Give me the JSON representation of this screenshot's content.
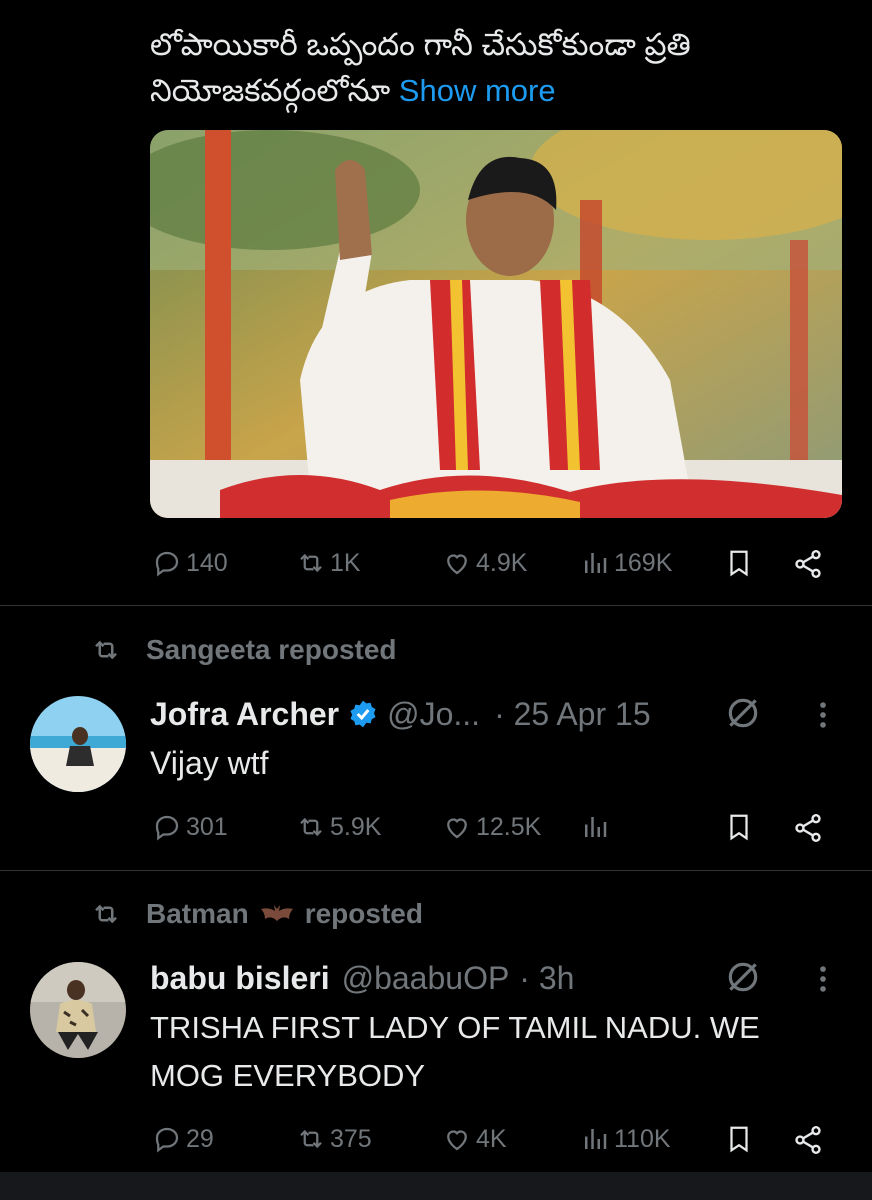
{
  "tweet1": {
    "text_line1": "లోపాయికారీ ఒప్పందం గానీ చేసుకోకుండా ప్రతి",
    "text_line2": "నియోజకవర్గంలోనూ",
    "show_more": "Show more",
    "actions": {
      "replies": "140",
      "reposts": "1K",
      "likes": "4.9K",
      "views": "169K"
    }
  },
  "tweet2": {
    "repost_by": "Sangeeta reposted",
    "name": "Jofra Archer",
    "handle": "@Jo...",
    "time": "· 25 Apr 15",
    "text": "Vijay wtf",
    "actions": {
      "replies": "301",
      "reposts": "5.9K",
      "likes": "12.5K"
    }
  },
  "tweet3": {
    "repost_name": "Batman",
    "repost_suffix": "reposted",
    "name": "babu bisleri",
    "handle": "@baabuOP",
    "time": "· 3h",
    "text_line1": "TRISHA FIRST LADY OF TAMIL NADU. WE",
    "text_line2": "MOG EVERYBODY",
    "actions": {
      "replies": "29",
      "reposts": "375",
      "likes": "4K",
      "views": "110K"
    }
  },
  "colors": {
    "accent": "#1d9bf0",
    "muted": "#71767b",
    "text": "#e7e9ea",
    "background": "#000000"
  }
}
